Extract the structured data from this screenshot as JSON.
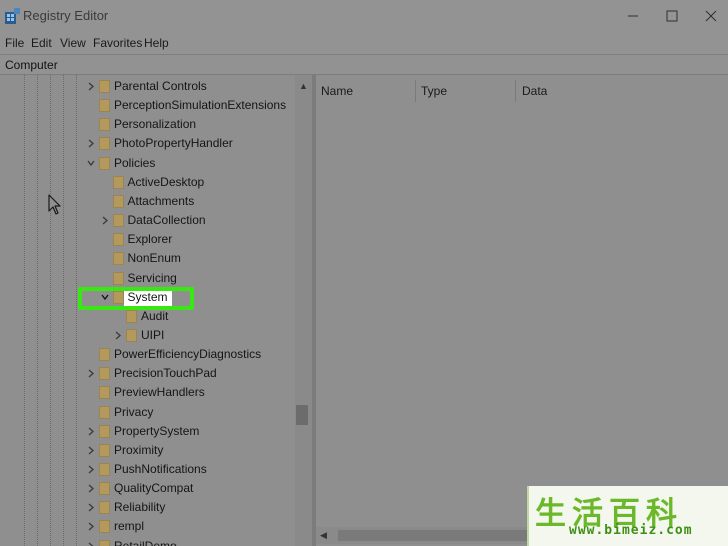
{
  "window": {
    "title": "Registry Editor",
    "icons": {
      "app": "registry-icon",
      "minimize": "minimize-icon",
      "maximize": "maximize-icon",
      "close": "close-icon"
    }
  },
  "menu": {
    "file": "File",
    "edit": "Edit",
    "view": "View",
    "favorites": "Favorites",
    "help": "Help"
  },
  "address": {
    "path": "Computer"
  },
  "tree": {
    "items": [
      {
        "label": "Parental Controls",
        "expander": "collapsed"
      },
      {
        "label": "PerceptionSimulationExtensions",
        "expander": "none"
      },
      {
        "label": "Personalization",
        "expander": "none"
      },
      {
        "label": "PhotoPropertyHandler",
        "expander": "collapsed"
      },
      {
        "label": "Policies",
        "expander": "expanded"
      },
      {
        "label": "ActiveDesktop",
        "expander": "none"
      },
      {
        "label": "Attachments",
        "expander": "none"
      },
      {
        "label": "DataCollection",
        "expander": "collapsed"
      },
      {
        "label": "Explorer",
        "expander": "none"
      },
      {
        "label": "NonEnum",
        "expander": "none"
      },
      {
        "label": "Servicing",
        "expander": "none"
      },
      {
        "label": "System",
        "expander": "expanded",
        "selected": true
      },
      {
        "label": "Audit",
        "expander": "none"
      },
      {
        "label": "UIPI",
        "expander": "collapsed"
      },
      {
        "label": "PowerEfficiencyDiagnostics",
        "expander": "none"
      },
      {
        "label": "PrecisionTouchPad",
        "expander": "collapsed"
      },
      {
        "label": "PreviewHandlers",
        "expander": "none"
      },
      {
        "label": "Privacy",
        "expander": "none"
      },
      {
        "label": "PropertySystem",
        "expander": "collapsed"
      },
      {
        "label": "Proximity",
        "expander": "collapsed"
      },
      {
        "label": "PushNotifications",
        "expander": "collapsed"
      },
      {
        "label": "QualityCompat",
        "expander": "collapsed"
      },
      {
        "label": "Reliability",
        "expander": "collapsed"
      },
      {
        "label": "rempl",
        "expander": "collapsed"
      },
      {
        "label": "RetailDemo",
        "expander": "collapsed"
      }
    ]
  },
  "list": {
    "columns": {
      "name": "Name",
      "type": "Type",
      "data": "Data"
    }
  },
  "colors": {
    "highlight": "#39e812",
    "folder": "#b39a5c",
    "background": "#8f8f8f"
  },
  "watermark": {
    "chars": "生活百科",
    "url": "www.bimeiz.com"
  }
}
